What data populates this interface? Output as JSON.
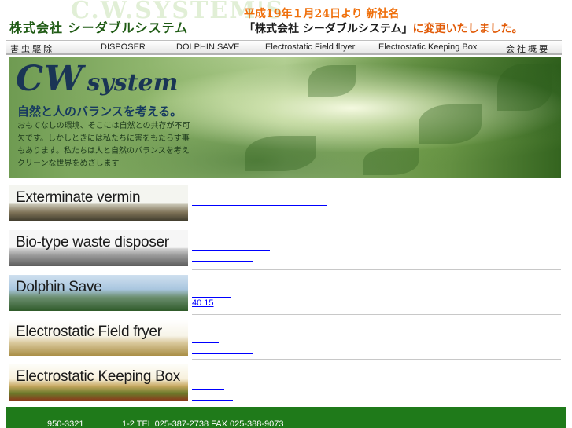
{
  "header": {
    "watermark": "C.W.SYSTEM'S",
    "company_jp": "株式会社 シーダブルシステム",
    "notice_line1": "平成19年１月24日より 新社名",
    "notice_line2_name": "「株式会社 シーダブルシステム」",
    "notice_line2_rest": "に変更いたしました。"
  },
  "nav": {
    "items": [
      {
        "label": "害 虫 駆 除"
      },
      {
        "label": "DISPOSER"
      },
      {
        "label": "DOLPHIN  SAVE"
      },
      {
        "label": "Electrostatic Field flryer"
      },
      {
        "label": "Electrostatic Keeping Box"
      },
      {
        "label": "会 社 概 要"
      }
    ]
  },
  "banner": {
    "logo_cw": "CW",
    "logo_system": "system",
    "tagline": "自然と人のバランスを考える。",
    "body": "おもてなしの環境、そこには自然との共存が不可欠です。しかしときには私たちに害をもたらす事もあります。私たちは人と自然のバランスを考えクリーンな世界をめざします"
  },
  "services": [
    {
      "label": "Exterminate vermin",
      "link1": "",
      "link2": ""
    },
    {
      "label": "Bio-type waste disposer",
      "link1": "",
      "link2": ""
    },
    {
      "label": "Dolphin Save",
      "link1": "",
      "link2": "40 15"
    },
    {
      "label": "Electrostatic Field fryer",
      "link1": "",
      "link2": ""
    },
    {
      "label": "Electrostatic Keeping Box",
      "link1": "",
      "link2": ""
    }
  ],
  "footer": {
    "postal": "950-3321",
    "address": "1-2 TEL 025-387-2738 FAX 025-388-9073"
  },
  "colors": {
    "company_green": "#1f5b14",
    "notice_orange": "#ef6f0a",
    "link_blue": "#0000ff",
    "footer_green": "#1f7a1a"
  }
}
